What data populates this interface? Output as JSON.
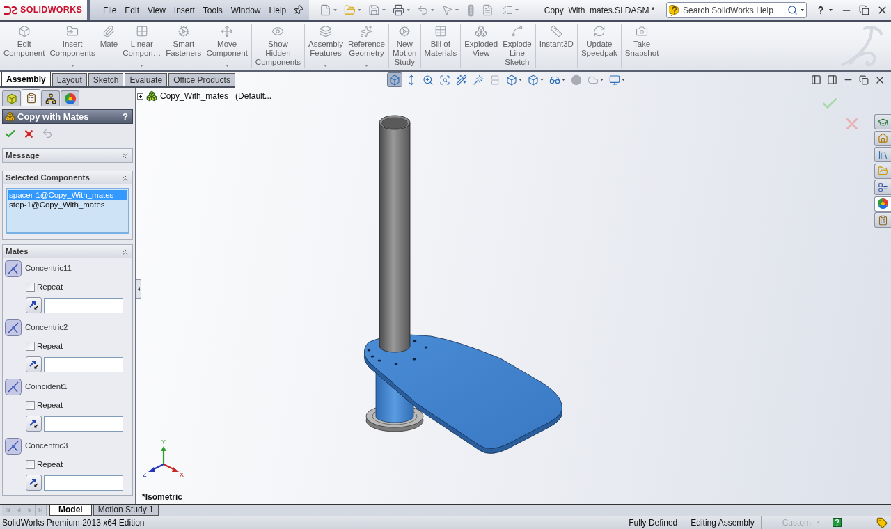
{
  "window": {
    "logo_text": "SOLIDWORKS",
    "title": "Copy_With_mates.SLDASM *"
  },
  "menu": [
    "File",
    "Edit",
    "View",
    "Insert",
    "Tools",
    "Window",
    "Help"
  ],
  "search": {
    "placeholder": "Search SolidWorks Help"
  },
  "ribbon": [
    [
      {
        "label": "Edit\nComponent",
        "dropdown": false
      },
      {
        "label": "Insert\nComponents",
        "dropdown": true
      },
      {
        "label": "Mate",
        "dropdown": false
      },
      {
        "label": "Linear\nCompon…",
        "dropdown": true
      },
      {
        "label": "Smart\nFasteners",
        "dropdown": false
      },
      {
        "label": "Move\nComponent",
        "dropdown": true
      }
    ],
    [
      {
        "label": "Show\nHidden\nComponents",
        "dropdown": false
      }
    ],
    [
      {
        "label": "Assembly\nFeatures",
        "dropdown": true
      },
      {
        "label": "Reference\nGeometry",
        "dropdown": true
      }
    ],
    [
      {
        "label": "New\nMotion\nStudy",
        "dropdown": false
      }
    ],
    [
      {
        "label": "Bill of\nMaterials",
        "dropdown": false
      }
    ],
    [
      {
        "label": "Exploded\nView",
        "dropdown": false
      },
      {
        "label": "Explode\nLine\nSketch",
        "dropdown": false
      }
    ],
    [
      {
        "label": "Instant3D",
        "dropdown": false
      }
    ],
    [
      {
        "label": "Update\nSpeedpak",
        "dropdown": false
      }
    ],
    [
      {
        "label": "Take\nSnapshot",
        "dropdown": false
      }
    ]
  ],
  "tabs": [
    {
      "label": "Assembly",
      "selected": true
    },
    {
      "label": "Layout",
      "selected": false
    },
    {
      "label": "Sketch",
      "selected": false
    },
    {
      "label": "Evaluate",
      "selected": false
    },
    {
      "label": "Office Products",
      "selected": false
    }
  ],
  "view_tools": [
    {
      "selected": true,
      "dropdown": false,
      "disabled": false
    },
    {
      "selected": false,
      "dropdown": false,
      "disabled": false
    },
    {
      "selected": false,
      "dropdown": false,
      "disabled": false
    },
    {
      "selected": false,
      "dropdown": false,
      "disabled": false
    },
    {
      "selected": false,
      "dropdown": false,
      "disabled": false
    },
    {
      "selected": false,
      "dropdown": false,
      "disabled": false
    },
    {
      "selected": false,
      "dropdown": false,
      "disabled": true
    },
    {
      "selected": false,
      "dropdown": true,
      "disabled": false
    },
    {
      "selected": false,
      "dropdown": true,
      "disabled": false
    },
    {
      "selected": false,
      "dropdown": true,
      "disabled": false
    },
    {
      "selected": false,
      "dropdown": false,
      "disabled": true
    },
    {
      "selected": false,
      "dropdown": true,
      "disabled": true
    },
    {
      "selected": false,
      "dropdown": true,
      "disabled": false
    }
  ],
  "panel": {
    "tabs": [
      {
        "selected": false
      },
      {
        "selected": true
      },
      {
        "selected": false
      },
      {
        "selected": false
      }
    ],
    "title": "Copy with Mates",
    "help": "?",
    "sections": [
      {
        "kind": "message",
        "title": "Message",
        "expanded": false
      },
      {
        "kind": "list",
        "title": "Selected Components",
        "expanded": true,
        "items": [
          {
            "label": "spacer-1@Copy_With_mates",
            "selected": true
          },
          {
            "label": "step-1@Copy_With_mates",
            "selected": false
          }
        ]
      },
      {
        "kind": "mates",
        "title": "Mates",
        "expanded": true,
        "mates": [
          {
            "name": "Concentric11",
            "repeat_label": "Repeat",
            "repeat": false
          },
          {
            "name": "Concentric2",
            "repeat_label": "Repeat",
            "repeat": false
          },
          {
            "name": "Coincident1",
            "repeat_label": "Repeat",
            "repeat": false
          },
          {
            "name": "Concentric3",
            "repeat_label": "Repeat",
            "repeat": false
          }
        ]
      }
    ]
  },
  "viewport": {
    "tree_root": {
      "name": "Copy_With_mates",
      "config": "(Default..."
    },
    "view_name": "*Isometric",
    "axis_labels": [
      "Y",
      "Z",
      "X"
    ]
  },
  "task_pane": [
    {
      "selected": false
    },
    {
      "selected": false
    },
    {
      "selected": false
    },
    {
      "selected": false
    },
    {
      "selected": false
    },
    {
      "selected": true
    },
    {
      "selected": false
    }
  ],
  "bottom_tabs": [
    {
      "label": "Model",
      "selected": true
    },
    {
      "label": "Motion Study 1",
      "selected": false
    }
  ],
  "status_bar": {
    "edition": "SolidWorks Premium 2013 x64 Edition",
    "items": [
      "Fully Defined",
      "Editing Assembly"
    ],
    "custom": {
      "label": "Custom",
      "disabled": true
    }
  }
}
